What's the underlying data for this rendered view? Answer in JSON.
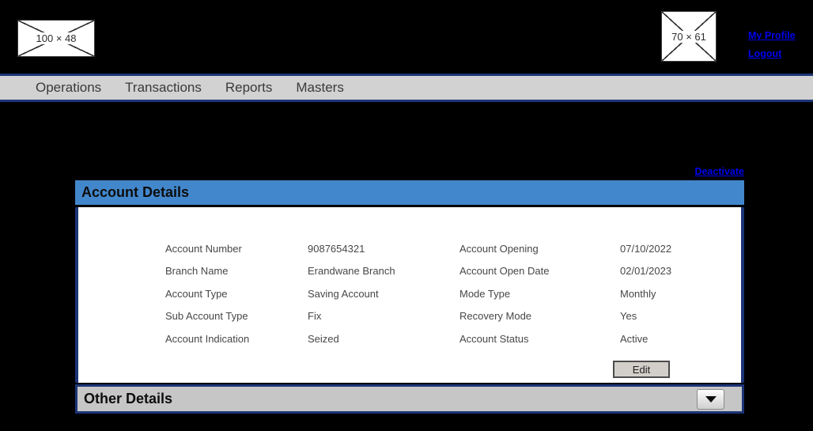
{
  "header": {
    "logo_placeholder": "100 × 48",
    "profile_placeholder": "70 × 61",
    "links": {
      "my_profile": "My Profile",
      "logout": "Logout"
    }
  },
  "nav": {
    "items": [
      "Operations",
      "Transactions",
      "Reports",
      "Masters"
    ]
  },
  "main": {
    "deactivate_link": "Deactivate",
    "account_panel": {
      "title": "Account Details",
      "left_fields": [
        {
          "label": "Account Number",
          "value": "9087654321"
        },
        {
          "label": "Branch Name",
          "value": "Erandwane Branch"
        },
        {
          "label": "Account Type",
          "value": "Saving Account"
        },
        {
          "label": "Sub Account Type",
          "value": "Fix"
        },
        {
          "label": "Account Indication",
          "value": "Seized"
        }
      ],
      "right_fields": [
        {
          "label": "Account Opening",
          "value": "07/10/2022"
        },
        {
          "label": "Account Open Date",
          "value": "02/01/2023"
        },
        {
          "label": "Mode Type",
          "value": "Monthly"
        },
        {
          "label": "Recovery Mode",
          "value": "Yes"
        },
        {
          "label": "Account Status",
          "value": "Active"
        }
      ],
      "edit_button": "Edit"
    },
    "other_panel": {
      "title": "Other Details"
    }
  },
  "colors": {
    "accent_blue": "#4287cb",
    "navy_border": "#1c3577",
    "link_blue": "#0000ee",
    "nav_gray": "#d2d2d2",
    "bar_gray": "#c6c6c6",
    "background": "#000000"
  }
}
